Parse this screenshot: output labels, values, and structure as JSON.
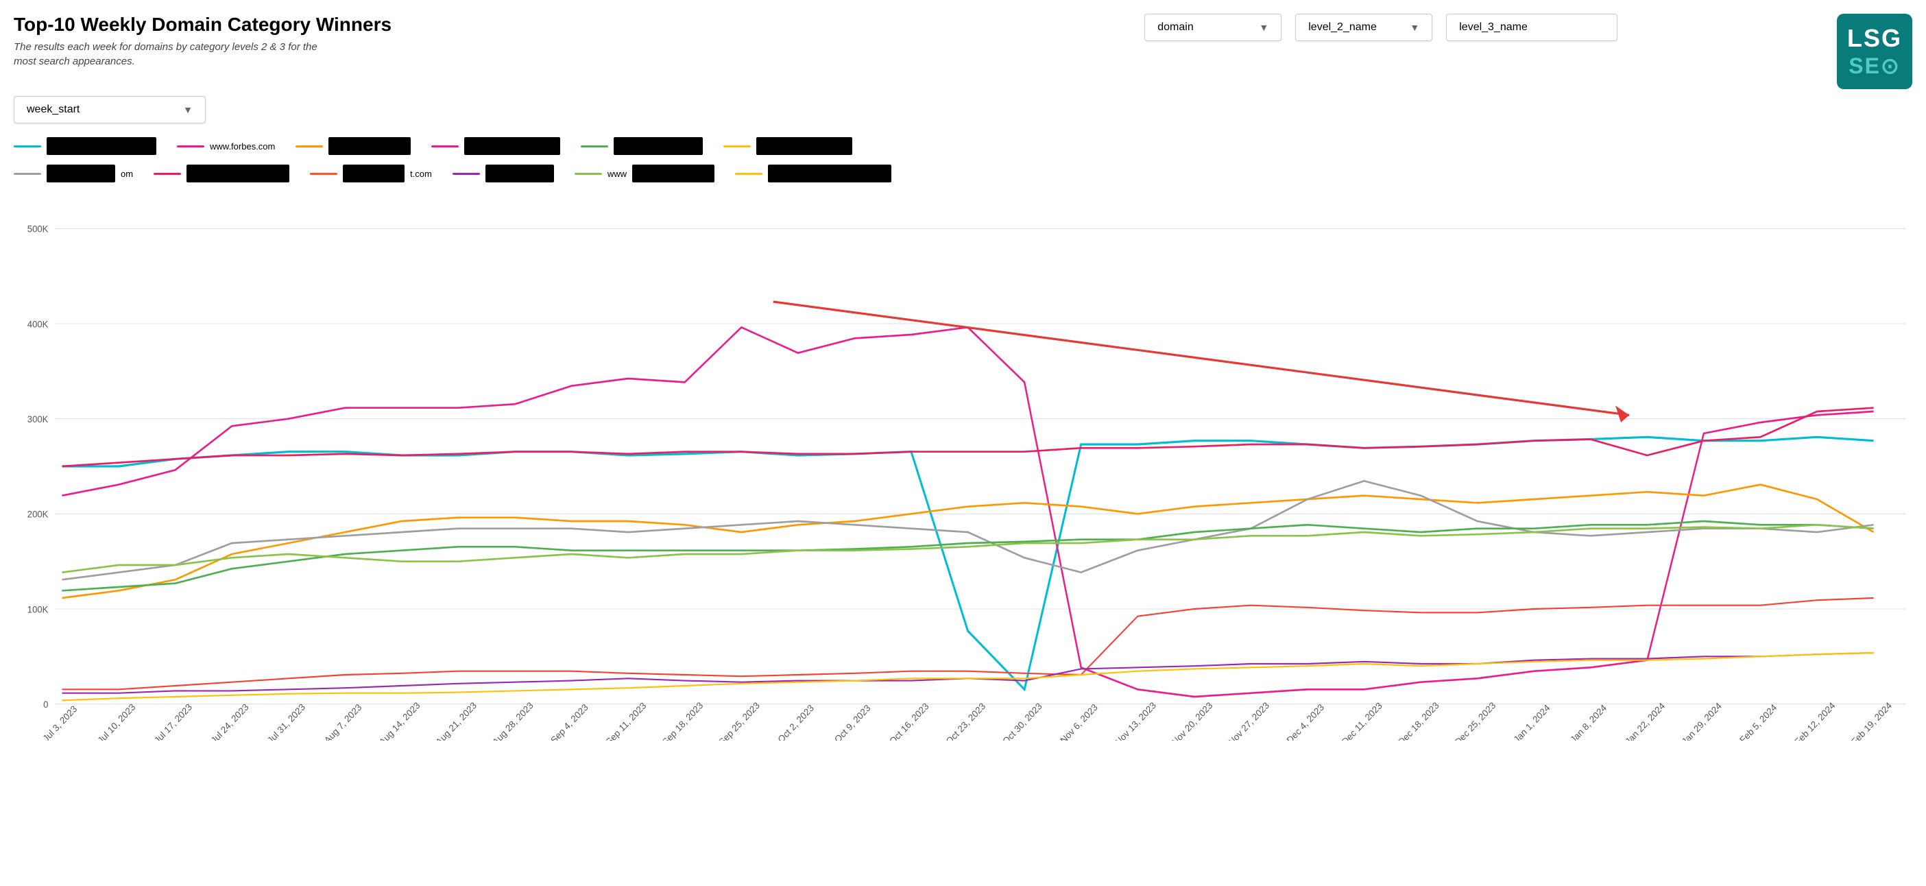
{
  "title": "Top-10 Weekly Domain Category Winners",
  "subtitle": "The results each week for domains by category levels 2 & 3 for the most search appearances.",
  "logo": {
    "line1": "LSG",
    "line2": "SEO"
  },
  "filters": {
    "row1": [
      {
        "id": "domain",
        "label": "domain",
        "has_arrow": true
      },
      {
        "id": "level2",
        "label": "level_2_name",
        "has_arrow": true
      },
      {
        "id": "level3",
        "label": "level_3_name",
        "has_arrow": false
      }
    ],
    "row2": [
      {
        "id": "week_start",
        "label": "week_start",
        "has_arrow": true
      }
    ]
  },
  "legend": [
    {
      "color": "#00bcd4",
      "label": "[redacted]"
    },
    {
      "color": "#e91e8c",
      "label": "www.forbes.com"
    },
    {
      "color": "#ff9800",
      "label": "[redacted]"
    },
    {
      "color": "#e91e8c",
      "label": "[redacted]"
    },
    {
      "color": "#4caf50",
      "label": "[redacted]"
    },
    {
      "color": "#ffc107",
      "label": "[redacted]"
    },
    {
      "color": "#9e9e9e",
      "label": "[redacted].om"
    },
    {
      "color": "#e91e63",
      "label": "[redacted]"
    },
    {
      "color": "#ff5722",
      "label": "[redacted].com"
    },
    {
      "color": "#9c27b0",
      "label": "[redacted]"
    },
    {
      "color": "#8bc34a",
      "label": "[redacted]"
    },
    {
      "color": "#ff5722",
      "label": "[redacted]"
    }
  ],
  "y_axis": {
    "labels": [
      "500K",
      "400K",
      "300K",
      "200K",
      "100K",
      "0"
    ]
  },
  "x_axis": {
    "labels": [
      "Jul 3, 2023",
      "Jul 10, 2023",
      "Jul 17, 2023",
      "Jul 24, 2023",
      "Jul 31, 2023",
      "Aug 7, 2023",
      "Aug 14, 2023",
      "Aug 21, 2023",
      "Aug 28, 2023",
      "Sep 4, 2023",
      "Sep 11, 2023",
      "Sep 18, 2023",
      "Sep 25, 2023",
      "Oct 2, 2023",
      "Oct 9, 2023",
      "Oct 16, 2023",
      "Oct 23, 2023",
      "Oct 30, 2023",
      "Nov 6, 2023",
      "Nov 13, 2023",
      "Nov 20, 2023",
      "Nov 27, 2023",
      "Dec 4, 2023",
      "Dec 11, 2023",
      "Dec 18, 2023",
      "Dec 25, 2023",
      "Jan 1, 2024",
      "Jan 8, 2024",
      "Jan 22, 2024",
      "Jan 29, 2024",
      "Feb 5, 2024",
      "Feb 12, 2024",
      "Feb 19, 2024"
    ]
  },
  "colors": {
    "cyan": "#00bcd4",
    "pink_hot": "#e91e8c",
    "orange": "#ff9800",
    "green": "#4caf50",
    "yellow": "#ffc107",
    "gray": "#9e9e9e",
    "red": "#f44336",
    "purple": "#9c27b0",
    "light_green": "#8bc34a",
    "red_arrow": "#e53935",
    "magenta": "#e91e63"
  }
}
